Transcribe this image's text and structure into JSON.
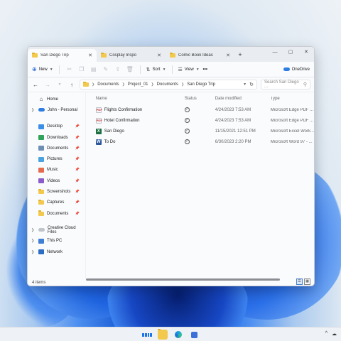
{
  "window": {
    "tabs": [
      {
        "label": "San Diego Trip",
        "active": true
      },
      {
        "label": "Cosplay Inspo",
        "active": false
      },
      {
        "label": "Comic Book Ideas",
        "active": false
      }
    ],
    "new_tab": "+",
    "controls": {
      "minimize": "—",
      "maximize": "▢",
      "close": "✕"
    }
  },
  "toolbar": {
    "new_label": "New",
    "sort_label": "Sort",
    "view_label": "View",
    "more_label": "•••",
    "onedrive_label": "OneDrive"
  },
  "address": {
    "breadcrumbs": [
      "Documents",
      "Project_01",
      "Documents",
      "San Diego Trip"
    ],
    "search_placeholder": "Search San Diego ..."
  },
  "sidebar": {
    "home": "Home",
    "john": "John - Personal",
    "quick": [
      "Desktop",
      "Downloads",
      "Documents",
      "Pictures",
      "Music",
      "Videos",
      "Screenshots",
      "Captures",
      "Documents"
    ],
    "creative": "Creative Cloud Files",
    "thispc": "This PC",
    "network": "Network"
  },
  "table": {
    "headers": {
      "name": "Name",
      "status": "Status",
      "date": "Date modified",
      "type": "Type"
    },
    "rows": [
      {
        "name": "Flights Confirmation",
        "date": "4/24/2023 7:53 AM",
        "type": "Microsoft Edge PDF ...",
        "icon": "pdf"
      },
      {
        "name": "Hotel Confirmation",
        "date": "4/24/2023 7:53 AM",
        "type": "Microsoft Edge PDF ...",
        "icon": "pdf"
      },
      {
        "name": "San Diego",
        "date": "11/15/2021 12:51 PM",
        "type": "Microsoft Excel Work...",
        "icon": "xls"
      },
      {
        "name": "To Do",
        "date": "6/30/2023 2:20 PM",
        "type": "Microsoft Word 97 - ...",
        "icon": "doc"
      }
    ]
  },
  "status": {
    "items": "4 items"
  },
  "colors": {
    "accent": "#1a5fd0",
    "folder": "#f2c94c"
  }
}
